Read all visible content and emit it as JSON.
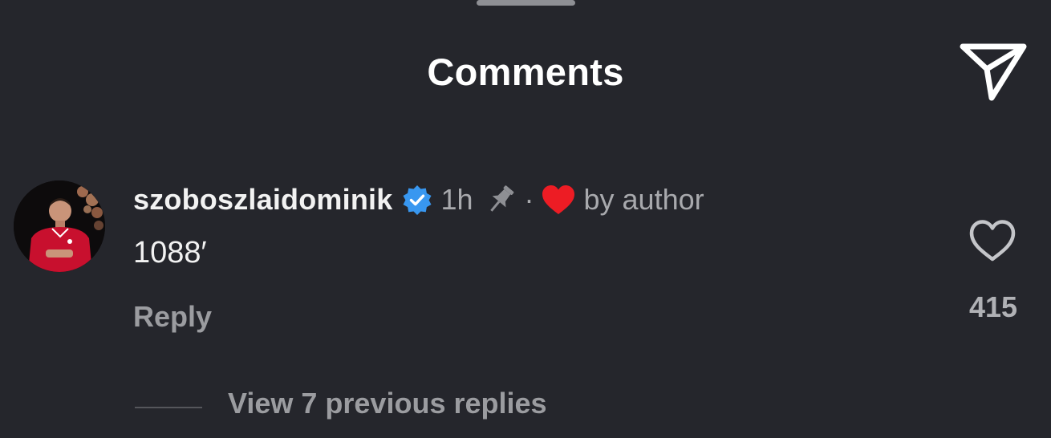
{
  "sheet": {
    "title": "Comments",
    "share_icon": "paper-plane-icon"
  },
  "comment": {
    "username": "szoboszlaidominik",
    "verified_icon": "verified-badge-icon",
    "time": "1h",
    "pin_icon": "pin-icon",
    "separator": "·",
    "author_like_icon": "heart-filled-icon",
    "liked_label": "by author",
    "text": "1088′",
    "reply_label": "Reply",
    "like_icon": "heart-outline-icon",
    "like_count": "415"
  },
  "replies": {
    "view_label": "View 7 previous replies"
  },
  "colors": {
    "background": "#25262c",
    "primary_text": "#f2f2f2",
    "secondary_text": "#a8a9ad",
    "verified_blue": "#3897f0",
    "heart_red": "#ed1c24"
  }
}
